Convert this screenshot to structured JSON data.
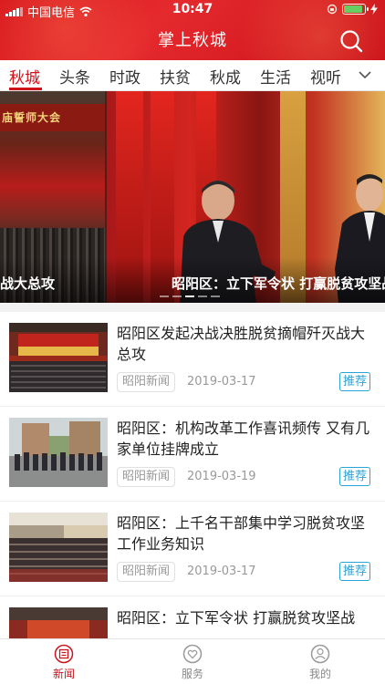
{
  "status_bar": {
    "carrier": "中国电信",
    "time": "10:47"
  },
  "header": {
    "title": "掌上秋城",
    "search_icon": "search-icon"
  },
  "tabs": [
    {
      "label": "秋城",
      "active": true
    },
    {
      "label": "头条"
    },
    {
      "label": "时政"
    },
    {
      "label": "扶贫"
    },
    {
      "label": "秋成"
    },
    {
      "label": "生活"
    },
    {
      "label": "视听"
    }
  ],
  "banner": {
    "slides": [
      {
        "caption": "战大总攻",
        "stage_text": "庙誓师大会"
      },
      {
        "caption": "昭阳区：立下军令状 打赢脱贫攻坚战"
      }
    ]
  },
  "news": [
    {
      "title": "昭阳区发起决战决胜脱贫摘帽歼灭战大总攻",
      "source": "昭阳新闻",
      "date": "2019-03-17",
      "tag": "推荐"
    },
    {
      "title": "昭阳区：机构改革工作喜讯频传 又有几家单位挂牌成立",
      "source": "昭阳新闻",
      "date": "2019-03-19",
      "tag": "推荐"
    },
    {
      "title": "昭阳区：上千名干部集中学习脱贫攻坚工作业务知识",
      "source": "昭阳新闻",
      "date": "2019-03-17",
      "tag": "推荐"
    },
    {
      "title": "昭阳区：立下军令状 打赢脱贫攻坚战"
    }
  ],
  "bottom_nav": [
    {
      "label": "新闻",
      "icon": "news-icon",
      "active": true
    },
    {
      "label": "服务",
      "icon": "heart-icon"
    },
    {
      "label": "我的",
      "icon": "user-icon"
    }
  ],
  "colors": {
    "brand_red": "#d0121b",
    "tag_blue": "#2aa3d8"
  }
}
